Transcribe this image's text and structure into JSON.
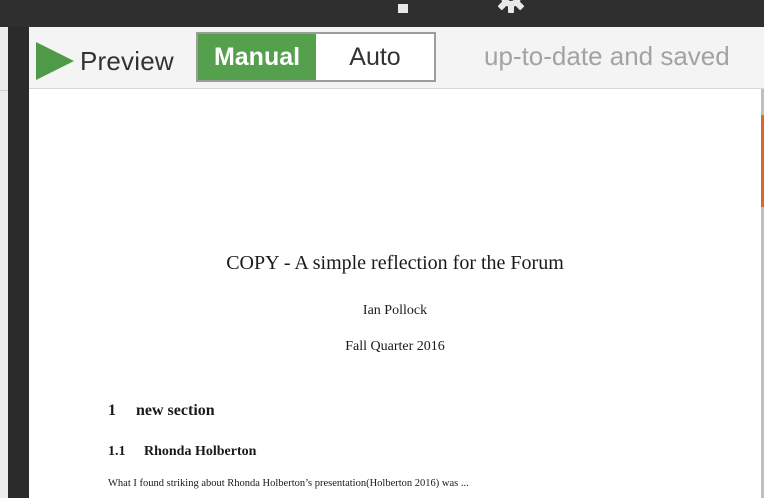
{
  "toolbar": {
    "preview_label": "Preview",
    "mode_options": [
      "Manual",
      "Auto"
    ],
    "selected_mode": "Manual",
    "status": "up-to-date and saved"
  },
  "icons": [
    "play-icon",
    "gear-icon"
  ],
  "colors": {
    "accent_green": "#55a04d",
    "play_green": "#4e9a48",
    "topbar": "#2f2f2f",
    "status_text": "#a3a3a3",
    "scroll_accent": "#d9682b"
  },
  "document": {
    "title": "COPY - A simple reflection for the Forum",
    "author": "Ian Pollock",
    "date": "Fall Quarter 2016",
    "section": {
      "number": "1",
      "title": "new section"
    },
    "subsection": {
      "number": "1.1",
      "title": "Rhonda Holberton"
    },
    "paragraph": "What I found striking about Rhonda Holberton’s presentation(Holberton 2016) was ..."
  }
}
